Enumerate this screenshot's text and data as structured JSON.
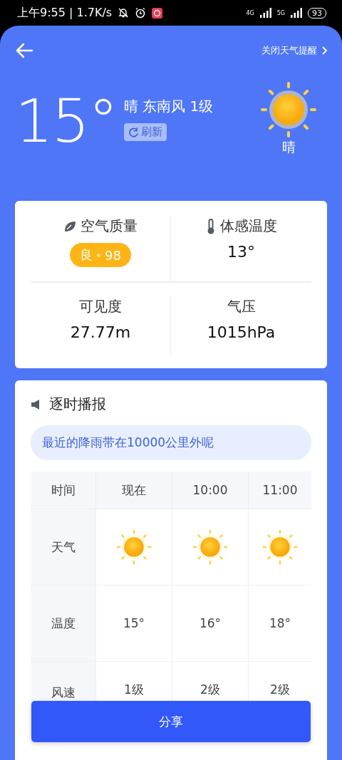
{
  "status_bar": {
    "time": "上午9:55 | 1.7K/s",
    "network_1": "4G",
    "network_2": "5G",
    "battery": "93"
  },
  "header": {
    "link": "关闭天气提醒"
  },
  "current": {
    "temperature": "15°",
    "summary": "晴 东南风 1级",
    "refresh": "刷新",
    "condition": "晴"
  },
  "details": [
    {
      "kind": "air",
      "label": "空气质量",
      "value": "良",
      "index": "98"
    },
    {
      "kind": "feels",
      "label": "体感温度",
      "value": "13°"
    },
    {
      "kind": "plain",
      "label": "可见度",
      "value": "27.77m"
    },
    {
      "kind": "plain",
      "label": "气压",
      "value": "1015hPa"
    }
  ],
  "hourly": {
    "title": "逐时播报",
    "notice": "最近的降雨带在10000公里外呢",
    "header": [
      "时间",
      "现在",
      "10:00",
      "11:00"
    ],
    "rows": [
      {
        "kind": "icon",
        "label": "天气",
        "cells": [
          "",
          "",
          ""
        ]
      },
      {
        "kind": "text",
        "label": "温度",
        "cells": [
          "15°",
          "16°",
          "18°"
        ]
      },
      {
        "kind": "text",
        "label": "风速",
        "cells": [
          "1级",
          "2级",
          "2级"
        ]
      }
    ]
  },
  "share_button": "分享"
}
